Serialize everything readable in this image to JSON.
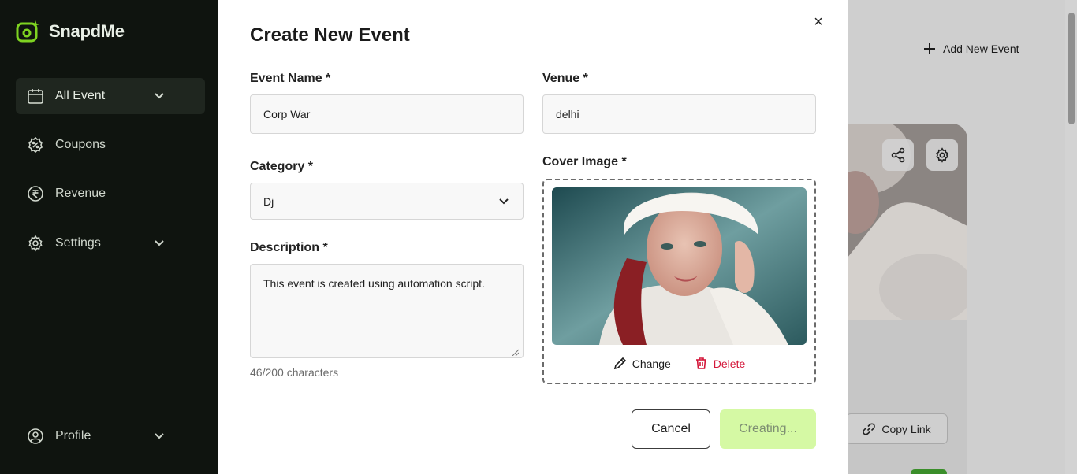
{
  "app": {
    "name": "SnapdMe"
  },
  "sidebar": {
    "items": [
      {
        "label": "All Event",
        "icon": "calendar-icon",
        "active": true,
        "expandable": true
      },
      {
        "label": "Coupons",
        "icon": "coupon-icon",
        "active": false,
        "expandable": false
      },
      {
        "label": "Revenue",
        "icon": "rupee-icon",
        "active": false,
        "expandable": false
      },
      {
        "label": "Settings",
        "icon": "gear-icon",
        "active": false,
        "expandable": true
      }
    ],
    "profile": {
      "label": "Profile",
      "icon": "user-circle-icon"
    }
  },
  "background": {
    "add_event_label": "Add New Event",
    "copy_link_label": "Copy Link"
  },
  "modal": {
    "title": "Create New Event",
    "close_icon": "×",
    "event_name": {
      "label": "Event Name *",
      "value": "Corp War"
    },
    "venue": {
      "label": "Venue *",
      "value": "delhi"
    },
    "category": {
      "label": "Category *",
      "value": "Dj"
    },
    "description": {
      "label": "Description *",
      "value": "This event is created using automation script.",
      "char_count": "46/200 characters"
    },
    "cover_image": {
      "label": "Cover Image *",
      "change_label": "Change",
      "delete_label": "Delete"
    },
    "cancel_label": "Cancel",
    "submit_label": "Creating..."
  },
  "colors": {
    "sidebar_bg": "#0f140f",
    "brand_green": "#7ed321",
    "submit_bg": "#d5f9a4",
    "delete_red": "#d4173a"
  }
}
